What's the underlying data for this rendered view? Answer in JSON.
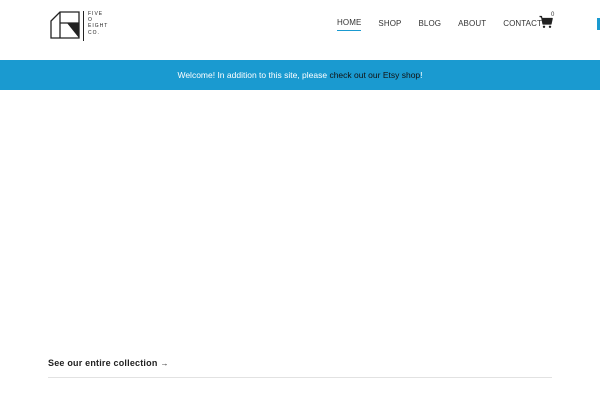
{
  "logo": {
    "lines": [
      "FIVE",
      "O",
      "EIGHT",
      "CO."
    ],
    "icon": "house-logo-icon"
  },
  "nav": {
    "items": [
      {
        "label": "HOME",
        "active": true
      },
      {
        "label": "SHOP",
        "active": false
      },
      {
        "label": "BLOG",
        "active": false
      },
      {
        "label": "ABOUT",
        "active": false
      },
      {
        "label": "CONTACT",
        "active": false
      }
    ],
    "cart_icon": "shopping-cart-icon",
    "cart_count": "0"
  },
  "banner": {
    "text_before": "Welcome! In addition to this site, please ",
    "link_text": "check out our Etsy shop",
    "text_after": "!"
  },
  "collection": {
    "link_label": "See our entire collection",
    "arrow": "→"
  },
  "colors": {
    "accent": "#1a9ad0",
    "text": "#222222",
    "background": "#ffffff"
  }
}
